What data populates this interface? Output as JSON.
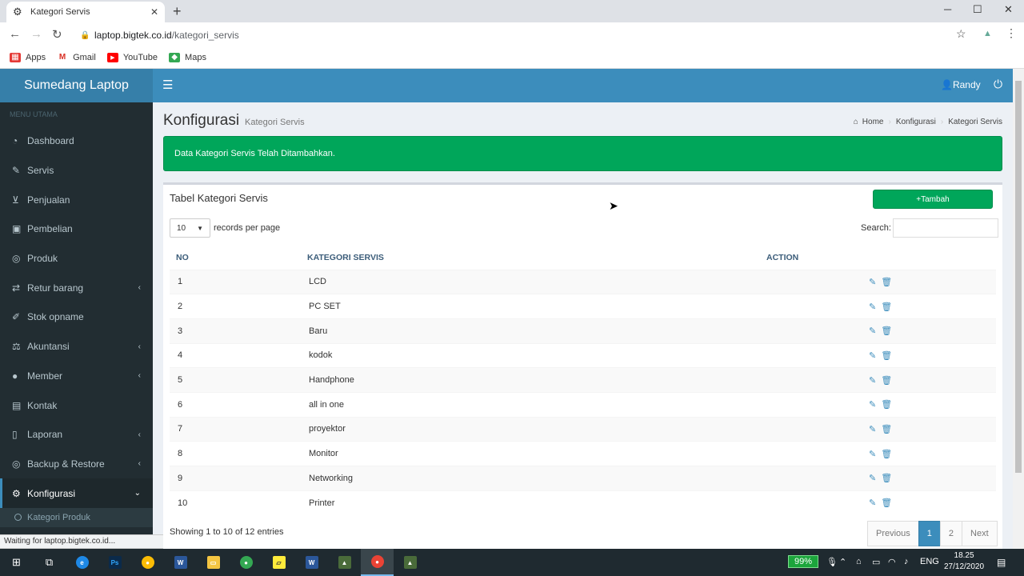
{
  "browser": {
    "tab_title": "Kategori Servis",
    "url_host": "laptop.bigtek.co.id",
    "url_path": "/kategori_servis",
    "bookmarks": [
      "Apps",
      "Gmail",
      "YouTube",
      "Maps"
    ],
    "status_text": "Waiting for laptop.bigtek.co.id..."
  },
  "header": {
    "logo": "Sumedang Laptop",
    "user": "Randy"
  },
  "sidebar": {
    "section": "MENU UTAMA",
    "items": [
      {
        "label": "Dashboard",
        "icon": "dashboard-icon",
        "chevron": false
      },
      {
        "label": "Servis",
        "icon": "wrench-icon",
        "chevron": false
      },
      {
        "label": "Penjualan",
        "icon": "cart-icon",
        "chevron": false
      },
      {
        "label": "Pembelian",
        "icon": "money-icon",
        "chevron": false
      },
      {
        "label": "Produk",
        "icon": "database-icon",
        "chevron": false
      },
      {
        "label": "Retur barang",
        "icon": "retweet-icon",
        "chevron": true
      },
      {
        "label": "Stok opname",
        "icon": "edit-icon",
        "chevron": false
      },
      {
        "label": "Akuntansi",
        "icon": "balance-icon",
        "chevron": true
      },
      {
        "label": "Member",
        "icon": "user-icon",
        "chevron": true
      },
      {
        "label": "Kontak",
        "icon": "address-card-icon",
        "chevron": false
      },
      {
        "label": "Laporan",
        "icon": "file-icon",
        "chevron": true
      },
      {
        "label": "Backup & Restore",
        "icon": "database-icon",
        "chevron": true
      },
      {
        "label": "Konfigurasi",
        "icon": "cogs-icon",
        "chevron": true
      }
    ],
    "sub_items": [
      "Kategori Produk"
    ]
  },
  "content": {
    "title": "Konfigurasi",
    "subtitle": "Kategori Servis",
    "breadcrumb": [
      "Home",
      "Konfigurasi",
      "Kategori Servis"
    ],
    "alert": "Data Kategori Servis Telah Ditambahkan."
  },
  "table_box": {
    "title": "Tabel Kategori Servis",
    "add_label": "+Tambah",
    "length_value": "10",
    "length_label": "records per page",
    "search_label": "Search:",
    "columns": [
      "NO",
      "KATEGORI SERVIS",
      "ACTION"
    ],
    "rows": [
      {
        "no": "1",
        "name": "LCD"
      },
      {
        "no": "2",
        "name": "PC SET"
      },
      {
        "no": "3",
        "name": "Baru"
      },
      {
        "no": "4",
        "name": "kodok"
      },
      {
        "no": "5",
        "name": "Handphone"
      },
      {
        "no": "6",
        "name": "all in one"
      },
      {
        "no": "7",
        "name": "proyektor"
      },
      {
        "no": "8",
        "name": "Monitor"
      },
      {
        "no": "9",
        "name": "Networking"
      },
      {
        "no": "10",
        "name": "Printer"
      }
    ],
    "info": "Showing 1 to 10 of 12 entries",
    "pagination": [
      "Previous",
      "1",
      "2",
      "Next"
    ]
  },
  "taskbar": {
    "battery": "99%",
    "lang": "ENG",
    "time": "18.25",
    "date": "27/12/2020"
  }
}
